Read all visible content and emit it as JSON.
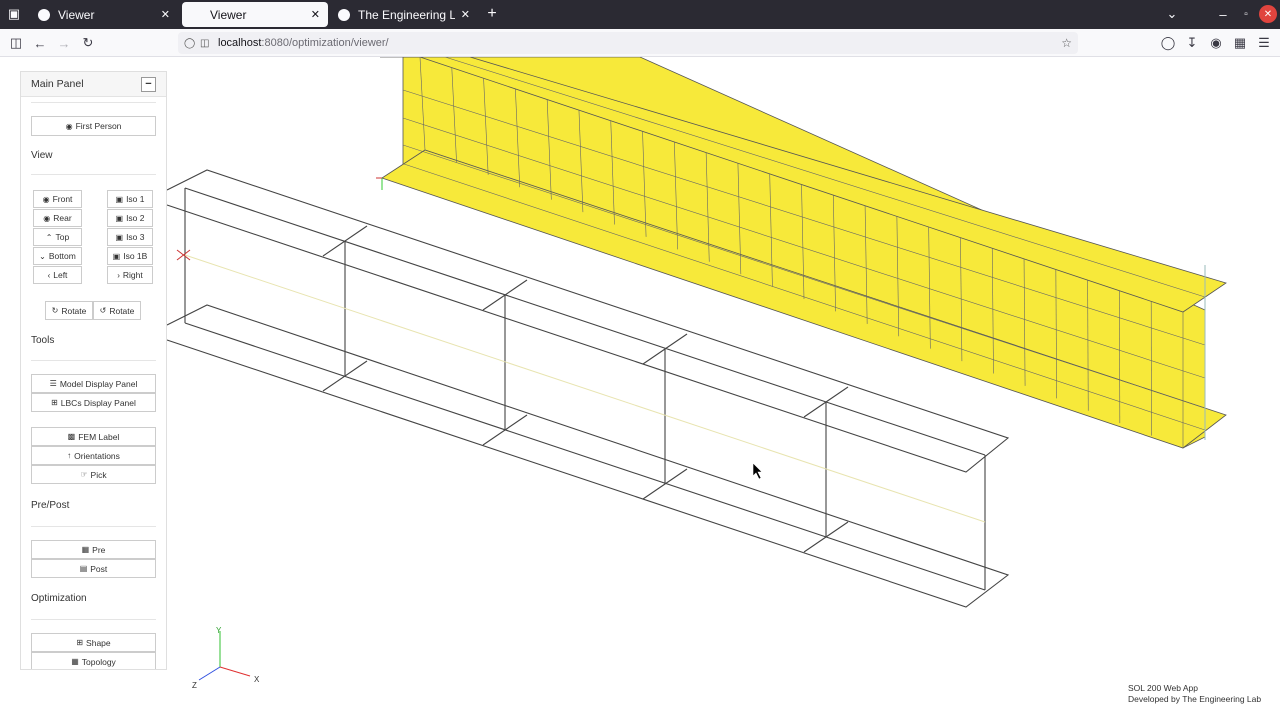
{
  "browser": {
    "tabs": [
      {
        "label": "Viewer",
        "active": false
      },
      {
        "label": "Viewer",
        "active": true
      },
      {
        "label": "The Engineering Lab | Na",
        "active": false
      }
    ],
    "url_host": "localhost",
    "url_rest": ":8080/optimization/viewer/"
  },
  "panel": {
    "title": "Main Panel",
    "collapse_label": "−",
    "first_person": "First Person",
    "sections": {
      "view": "View",
      "tools": "Tools",
      "prepost": "Pre/Post",
      "optimization": "Optimization"
    },
    "view_buttons": {
      "front": "Front",
      "rear": "Rear",
      "top": "Top",
      "bottom": "Bottom",
      "left": "Left",
      "iso1": "Iso 1",
      "iso2": "Iso 2",
      "iso3": "Iso 3",
      "iso1b": "Iso 1B",
      "right": "Right"
    },
    "rotate_cw": "Rotate",
    "rotate_ccw": "Rotate",
    "tools": {
      "model_display": "Model Display Panel",
      "lbcs_display": "LBCs Display Panel",
      "fem_label": "FEM Label",
      "orientations": "Orientations",
      "pick": "Pick"
    },
    "prepost": {
      "pre": "Pre",
      "post": "Post"
    },
    "optimization": {
      "shape": "Shape",
      "topology": "Topology"
    }
  },
  "axes": {
    "x": "X",
    "y": "Y",
    "z": "Z"
  },
  "footer": {
    "line1": "SOL 200 Web App",
    "line2": "Developed by The Engineering Lab"
  },
  "colors": {
    "mesh_fill": "#f7e93a",
    "mesh_line": "#555555",
    "wire": "#444444",
    "axis_x": "#e03030",
    "axis_y": "#30c030",
    "axis_z": "#3050e0"
  }
}
